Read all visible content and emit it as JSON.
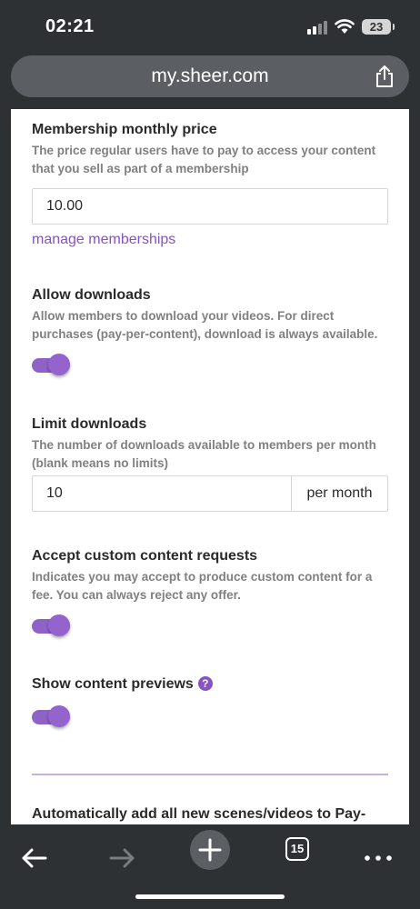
{
  "status_bar": {
    "time": "02:21",
    "battery": "23"
  },
  "browser": {
    "url": "my.sheer.com",
    "tabs_count": "15"
  },
  "settings": {
    "membership_price": {
      "title": "Membership monthly price",
      "description": "The price regular users have to pay to access your content that you sell as part of a membership",
      "value": "10.00",
      "link": "manage memberships"
    },
    "allow_downloads": {
      "title": "Allow downloads",
      "description": "Allow members to download your videos. For direct purchases (pay-per-content), download is always available.",
      "enabled": true
    },
    "limit_downloads": {
      "title": "Limit downloads",
      "description": "The number of downloads available to members per month (blank means no limits)",
      "value": "10",
      "unit": "per month"
    },
    "custom_requests": {
      "title": "Accept custom content requests",
      "description": "Indicates you may accept to produce custom content for a fee. You can always reject any offer.",
      "enabled": true
    },
    "content_previews": {
      "title": "Show content previews",
      "help": "?",
      "enabled": true
    },
    "auto_add": {
      "title": "Automatically add all new scenes/videos to Pay-"
    }
  },
  "colors": {
    "accent": "#8752c2",
    "toggle": "#9563cc",
    "chrome": "#2e3134",
    "url_bar": "#5b5f63"
  },
  "icons": [
    "share-icon",
    "back-arrow-icon",
    "forward-arrow-icon",
    "plus-icon",
    "more-icon",
    "question-icon",
    "wifi-icon",
    "signal-icon",
    "battery-icon"
  ]
}
